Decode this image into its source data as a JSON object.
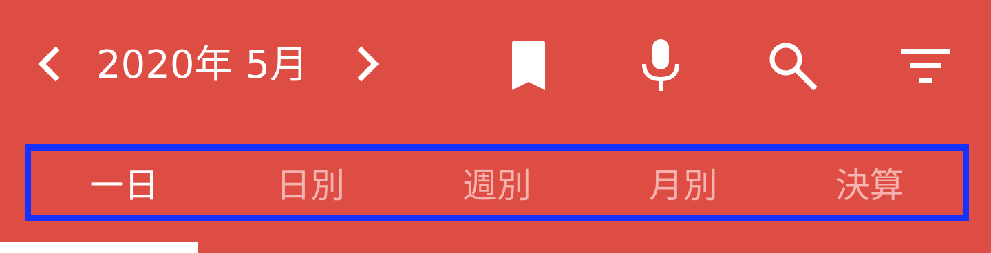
{
  "header": {
    "month_label": "2020年 5月",
    "prev_icon": "chevron-left-icon",
    "next_icon": "chevron-right-icon",
    "actions": [
      {
        "icon": "bookmark-icon"
      },
      {
        "icon": "microphone-icon"
      },
      {
        "icon": "search-icon"
      },
      {
        "icon": "filter-icon"
      }
    ]
  },
  "tabs": [
    {
      "label": "一日",
      "active": true
    },
    {
      "label": "日別",
      "active": false
    },
    {
      "label": "週別",
      "active": false
    },
    {
      "label": "月別",
      "active": false
    },
    {
      "label": "決算",
      "active": false
    }
  ],
  "colors": {
    "appbar": "#DE4D43",
    "tab_active": "#FFFFFF",
    "tab_inactive": "#F4B3AE",
    "highlight_border": "#1530FF",
    "indicator": "#FFFFFF"
  }
}
